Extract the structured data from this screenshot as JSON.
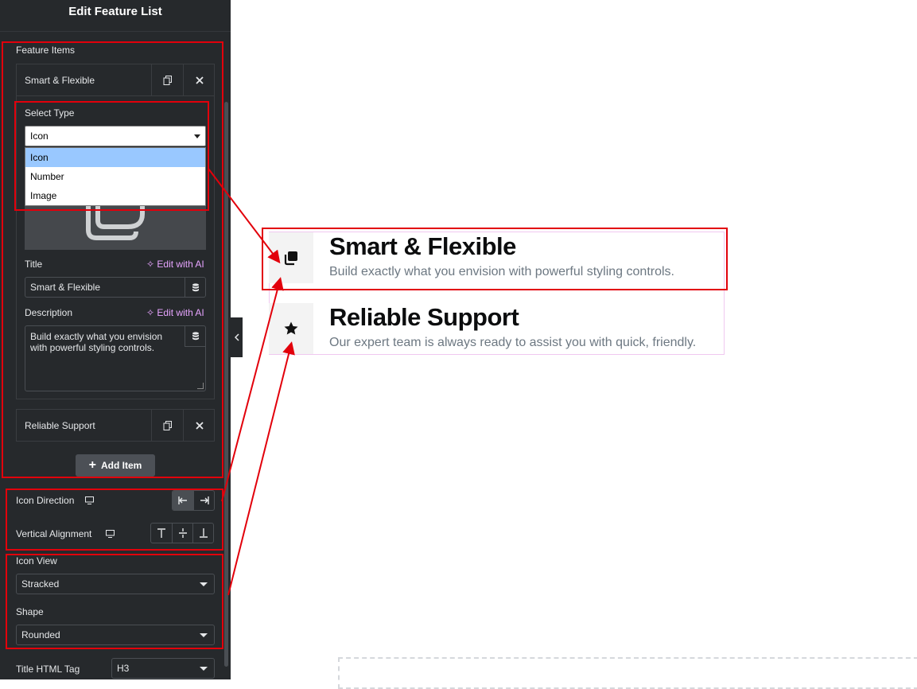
{
  "sidebar": {
    "header": "Edit Feature List",
    "feature_items_label": "Feature Items",
    "items": [
      {
        "title": "Smart & Flexible"
      },
      {
        "title": "Reliable Support"
      }
    ],
    "select_type": {
      "label": "Select Type",
      "value": "Icon",
      "options": [
        "Icon",
        "Number",
        "Image"
      ]
    },
    "title_field": {
      "label": "Title",
      "value": "Smart & Flexible",
      "ai_label": "Edit with AI"
    },
    "description_field": {
      "label": "Description",
      "value": "Build exactly what you envision with powerful styling controls.",
      "ai_label": "Edit with AI"
    },
    "add_item_label": "Add Item",
    "icon_direction_label": "Icon Direction",
    "vertical_alignment_label": "Vertical Alignment",
    "icon_view": {
      "label": "Icon View",
      "value": "Stracked"
    },
    "shape": {
      "label": "Shape",
      "value": "Rounded"
    },
    "title_html_tag": {
      "label": "Title HTML Tag",
      "value": "H3"
    }
  },
  "preview": {
    "features": [
      {
        "icon": "copy-icon",
        "title": "Smart & Flexible",
        "description": "Build exactly what you envision with powerful styling controls."
      },
      {
        "icon": "star-icon",
        "title": "Reliable Support",
        "description": "Our expert team is always ready to assist you with quick, friendly."
      }
    ]
  },
  "colors": {
    "sidebar_bg": "#26292c",
    "annotation_red": "#e2000b",
    "ai_accent": "#e7a4ff",
    "selected_option": "#99c8ff"
  }
}
